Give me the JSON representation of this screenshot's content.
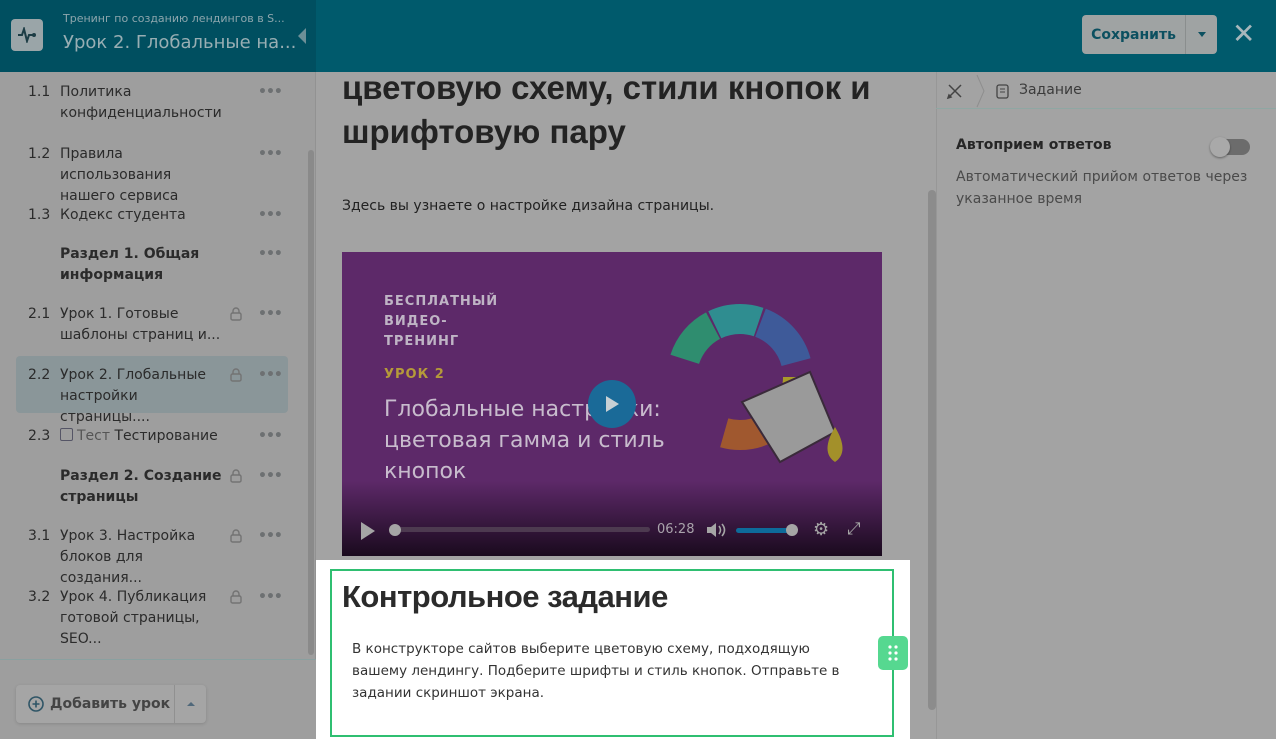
{
  "header": {
    "course_title": "Тренинг по созданию лендингов в S...",
    "lesson_title": "Урок 2. Глобальные на...",
    "save_label": "Сохранить"
  },
  "sidebar": {
    "items": [
      {
        "num": "1.1",
        "label": "Политика конфиденциальности",
        "lock": false
      },
      {
        "num": "1.2",
        "label": "Правила использования нашего сервиса",
        "lock": false
      },
      {
        "num": "1.3",
        "label": "Кодекс студента",
        "lock": false
      },
      {
        "num": "",
        "label": "Раздел 1. Общая информация",
        "lock": false
      },
      {
        "num": "2.1",
        "label": "Урок 1. Готовые шаблоны страниц и...",
        "lock": true
      },
      {
        "num": "2.2",
        "label": "Урок 2. Глобальные настройки страницы....",
        "lock": true
      },
      {
        "num": "2.3",
        "prefix": "Тест",
        "label": "Тестирование",
        "lock": false
      },
      {
        "num": "",
        "label": "Раздел 2. Создание страницы",
        "lock": true
      },
      {
        "num": "3.1",
        "label": "Урок 3. Настройка блоков для создания...",
        "lock": true
      },
      {
        "num": "3.2",
        "label": "Урок 4. Публикация готовой страницы, SEO...",
        "lock": true
      }
    ],
    "add_lesson_label": "Добавить урок"
  },
  "content": {
    "title": "цветовую схему, стили кнопок и шрифтовую пару",
    "intro": "Здесь вы узнаете о настройке дизайна страницы.",
    "video": {
      "tag": "БЕСПЛАТНЫЙ ВИДЕО-ТРЕНИНГ",
      "lesson": "УРОК 2",
      "headline": "Глобальные настройки: цветовая гамма и стиль кнопок",
      "duration": "06:28",
      "progress": 0,
      "volume": 1.0
    },
    "task": {
      "title": "Контрольное задание",
      "text": "В конструкторе сайтов выберите цветовую схему, подходящую вашему лендингу.  Подберите шрифты и стиль кнопок. Отправьте в задании скриншот экрана."
    }
  },
  "right_panel": {
    "tab_label": "Задание",
    "auto_accept_label": "Автоприем ответов",
    "auto_accept_desc": "Автоматический прийом ответов через указанное время",
    "auto_accept_on": false
  }
}
